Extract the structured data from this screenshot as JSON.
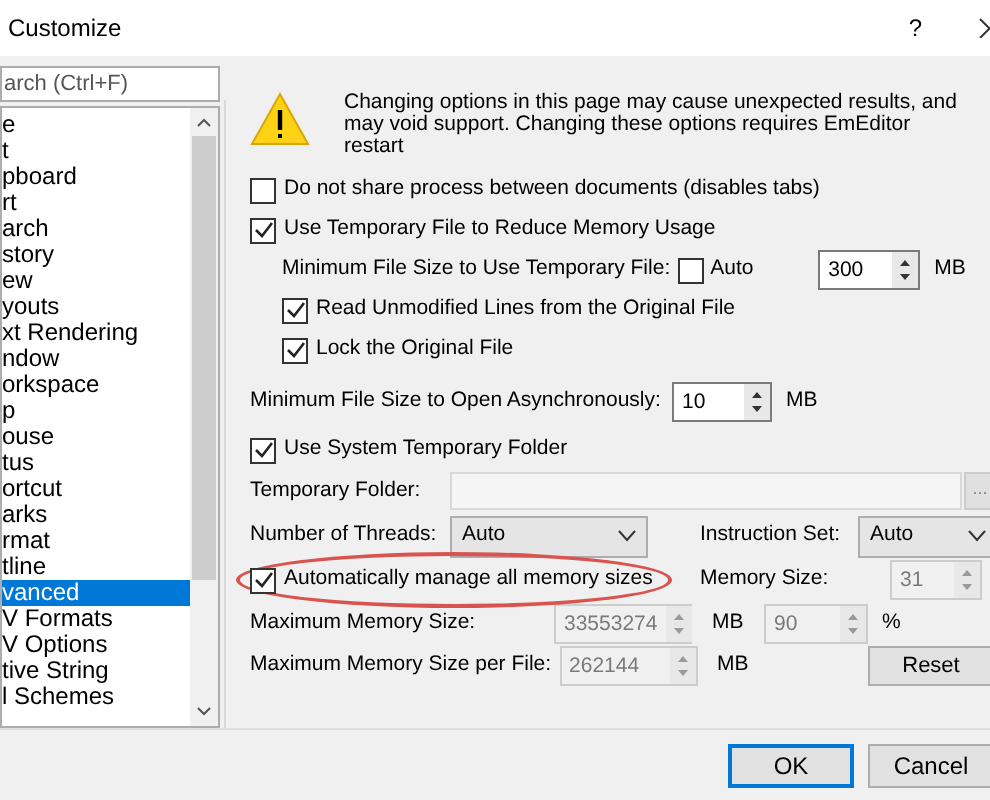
{
  "window": {
    "title": "Customize",
    "help": "?"
  },
  "sidebar": {
    "search": {
      "placeholder": "arch (Ctrl+F)"
    },
    "items": [
      {
        "label": "e",
        "selected": false
      },
      {
        "label": "t",
        "selected": false
      },
      {
        "label": "pboard",
        "selected": false
      },
      {
        "label": "rt",
        "selected": false
      },
      {
        "label": "arch",
        "selected": false
      },
      {
        "label": "story",
        "selected": false
      },
      {
        "label": "ew",
        "selected": false
      },
      {
        "label": "youts",
        "selected": false
      },
      {
        "label": "xt Rendering",
        "selected": false
      },
      {
        "label": "ndow",
        "selected": false
      },
      {
        "label": "orkspace",
        "selected": false
      },
      {
        "label": "p",
        "selected": false
      },
      {
        "label": "ouse",
        "selected": false
      },
      {
        "label": "tus",
        "selected": false
      },
      {
        "label": "ortcut",
        "selected": false
      },
      {
        "label": "arks",
        "selected": false
      },
      {
        "label": "rmat",
        "selected": false
      },
      {
        "label": "tline",
        "selected": false
      },
      {
        "label": "vanced",
        "selected": true
      },
      {
        "label": "V Formats",
        "selected": false
      },
      {
        "label": "V Options",
        "selected": false
      },
      {
        "label": "tive String",
        "selected": false
      },
      {
        "label": "l Schemes",
        "selected": false
      }
    ]
  },
  "warning": {
    "text": "Changing options in this page may cause unexpected results, and may void support. Changing these options requires EmEditor restart"
  },
  "options": {
    "share_process": {
      "label": "Do not share process between documents (disables tabs)",
      "checked": false
    },
    "use_temp_file": {
      "label": "Use Temporary File to Reduce Memory Usage",
      "checked": true
    },
    "min_temp_size": {
      "label": "Minimum File Size to Use Temporary File:",
      "auto": {
        "label": "Auto",
        "checked": false
      },
      "value": "300",
      "unit": "MB"
    },
    "read_unmodified": {
      "label": "Read Unmodified Lines from the Original File",
      "checked": true
    },
    "lock_original": {
      "label": "Lock the Original File",
      "checked": true
    },
    "min_async": {
      "label": "Minimum File Size to Open Asynchronously:",
      "value": "10",
      "unit": "MB"
    },
    "use_system_temp": {
      "label": "Use System Temporary Folder",
      "checked": true
    },
    "temp_folder": {
      "label": "Temporary Folder:",
      "disabled": true,
      "browse": "..."
    },
    "threads": {
      "label": "Number of Threads:",
      "value": "Auto"
    },
    "instruction_set": {
      "label": "Instruction Set:",
      "value": "Auto"
    },
    "auto_manage": {
      "label": "Automatically manage all memory sizes",
      "checked": true,
      "highlighted": true
    },
    "memory_size": {
      "label": "Memory Size:",
      "value": "31",
      "disabled": true
    },
    "max_memory": {
      "label": "Maximum Memory Size:",
      "value": "33553274",
      "unit": "MB",
      "percent": "90",
      "percent_unit": "%",
      "disabled": true
    },
    "max_per_file": {
      "label": "Maximum Memory Size per File:",
      "value": "262144",
      "unit": "MB",
      "disabled": true
    },
    "reset": "Reset"
  },
  "buttons": [
    {
      "label": "OK",
      "default": true
    },
    {
      "label": "Cancel",
      "default": false
    }
  ]
}
